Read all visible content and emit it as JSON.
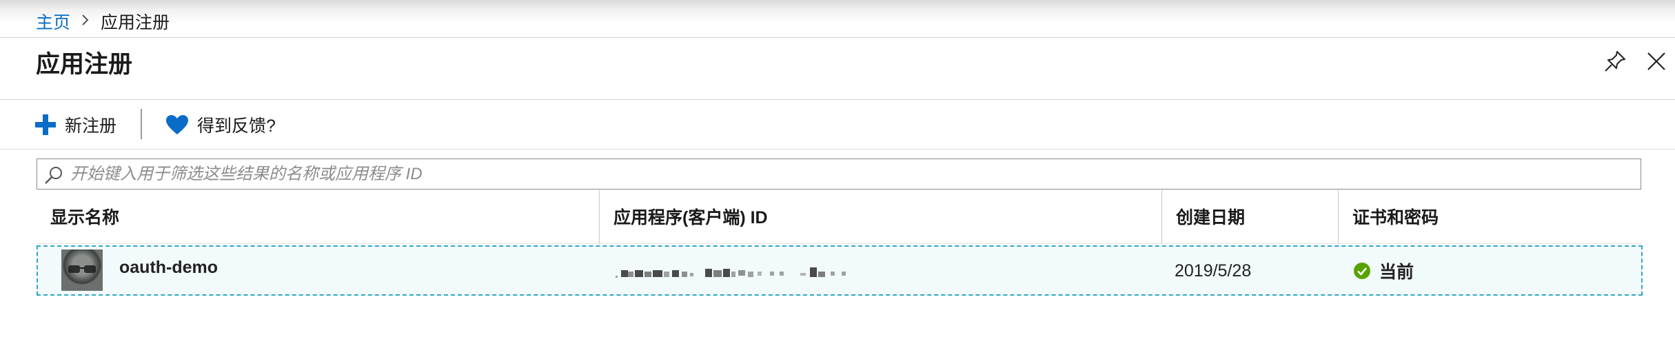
{
  "breadcrumb": {
    "home_label": "主页",
    "current_label": "应用注册"
  },
  "header": {
    "title": "应用注册"
  },
  "toolbar": {
    "new_registration_label": "新注册",
    "feedback_label": "得到反馈?"
  },
  "filter": {
    "placeholder": "开始键入用于筛选这些结果的名称或应用程序 ID",
    "value": ""
  },
  "table": {
    "columns": [
      "显示名称",
      "应用程序(客户端) ID",
      "创建日期",
      "证书和密码"
    ],
    "rows": [
      {
        "display_name": "oauth-demo",
        "client_id": "",
        "created": "2019/5/28",
        "certificate_status": "当前"
      }
    ]
  },
  "colors": {
    "link": "#0b6cc8",
    "accent": "#0078d4",
    "status_ok": "#57a300",
    "row_selection": "#2fa6c8"
  },
  "icons": {
    "pin": "pin-icon",
    "close": "close-icon",
    "add": "plus-icon",
    "feedback": "heart-icon",
    "search": "search-icon",
    "status": "check-circle-icon"
  }
}
